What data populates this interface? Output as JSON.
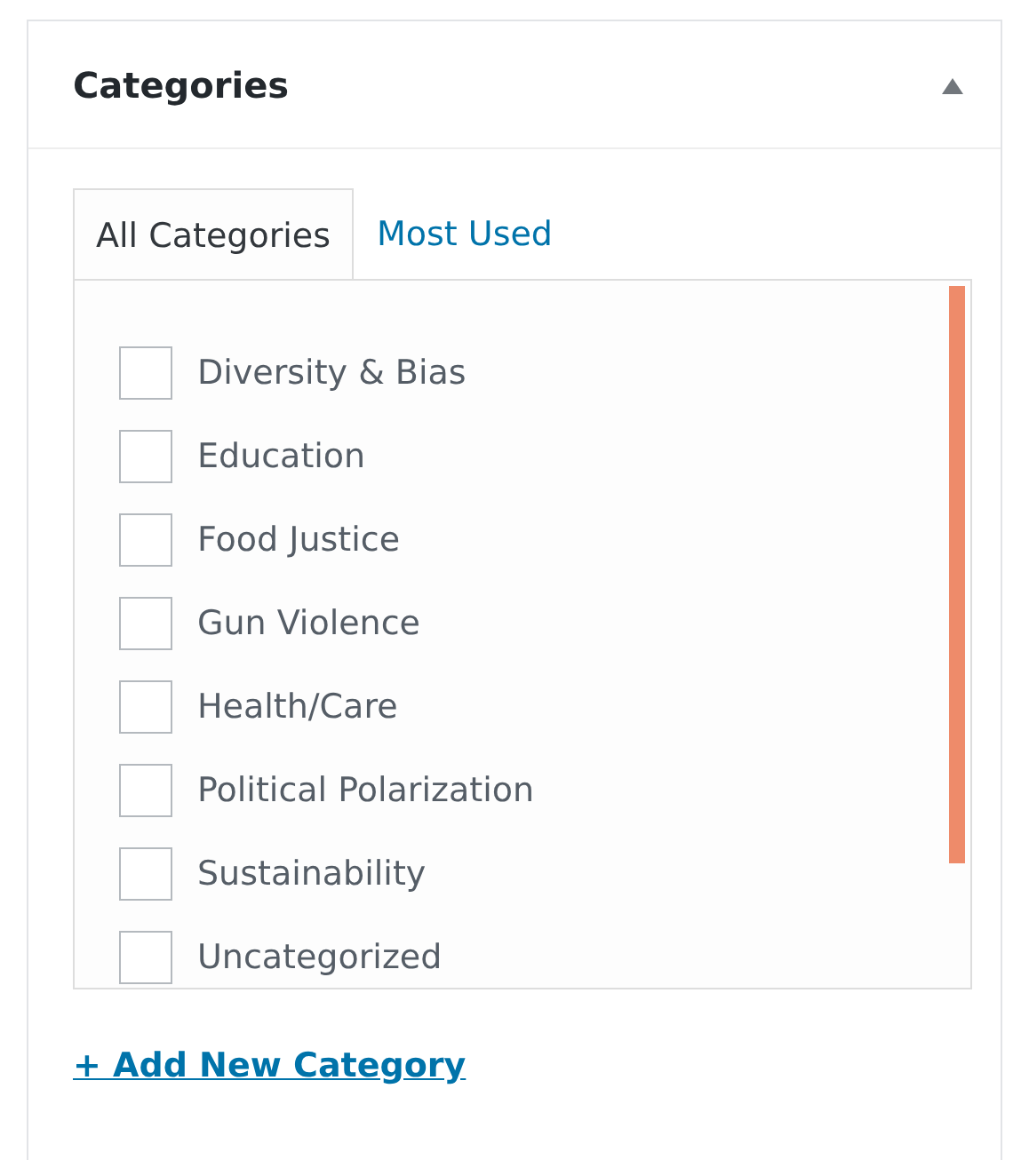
{
  "panel": {
    "title": "Categories",
    "expanded": true
  },
  "tabs": [
    {
      "label": "All Categories",
      "selected": true
    },
    {
      "label": "Most Used",
      "selected": false
    }
  ],
  "categories": [
    {
      "label": "Diversity & Bias",
      "checked": false
    },
    {
      "label": "Education",
      "checked": false
    },
    {
      "label": "Food Justice",
      "checked": false
    },
    {
      "label": "Gun Violence",
      "checked": false
    },
    {
      "label": "Health/Care",
      "checked": false
    },
    {
      "label": "Political Polarization",
      "checked": false
    },
    {
      "label": "Sustainability",
      "checked": false
    },
    {
      "label": "Uncategorized",
      "checked": false
    }
  ],
  "add_link": "+ Add New Category"
}
